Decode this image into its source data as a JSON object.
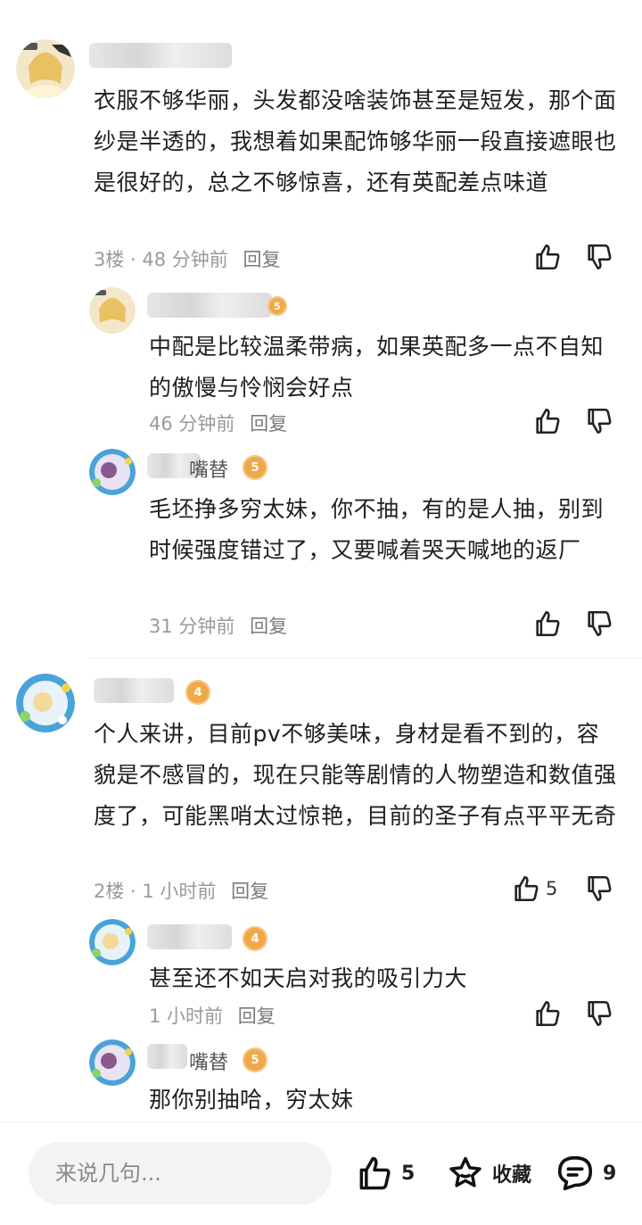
{
  "comments": [
    {
      "text": "衣服不够华丽，头发都没啥装饰甚至是短发，那个面纱是半透的，我想着如果配饰够华丽一段直接遮眼也是很好的，总之不够惊喜，还有英配差点味道",
      "floor": "3楼 · 48 分钟前",
      "reply": "回复",
      "replies": [
        {
          "level": "5",
          "text": "中配是比较温柔带病，如果英配多一点不自知的傲慢与怜悯会好点",
          "time": "46 分钟前",
          "reply": "回复"
        },
        {
          "name_suffix": "嘴替",
          "level": "5",
          "text": "毛坯挣多穷太妹，你不抽，有的是人抽，别到时候强度错过了，又要喊着哭天喊地的返厂",
          "time": "31 分钟前",
          "reply": "回复"
        }
      ]
    },
    {
      "level": "4",
      "text": "个人来讲，目前pv不够美味，身材是看不到的，容貌是不感冒的，现在只能等剧情的人物塑造和数值强度了，可能黑哨太过惊艳，目前的圣子有点平平无奇",
      "floor": "2楼 · 1 小时前",
      "reply": "回复",
      "likes": "5",
      "replies": [
        {
          "level": "4",
          "text": "甚至还不如天启对我的吸引力大",
          "time": "1 小时前",
          "reply": "回复"
        },
        {
          "name_suffix": "嘴替",
          "level": "5",
          "text": "那你别抽哈，穷太妹"
        }
      ]
    }
  ],
  "bottom_bar": {
    "input_placeholder": "来说几句...",
    "like_count": "5",
    "collect_label": "收藏",
    "comment_count": "9"
  },
  "icons": {
    "like": "thumbs-up-icon",
    "dislike": "thumbs-down-icon",
    "star": "star-icon",
    "comment": "comment-icon"
  },
  "colors": {
    "level_badge": "#f0a94a",
    "meta_text": "#9a9a9a"
  }
}
